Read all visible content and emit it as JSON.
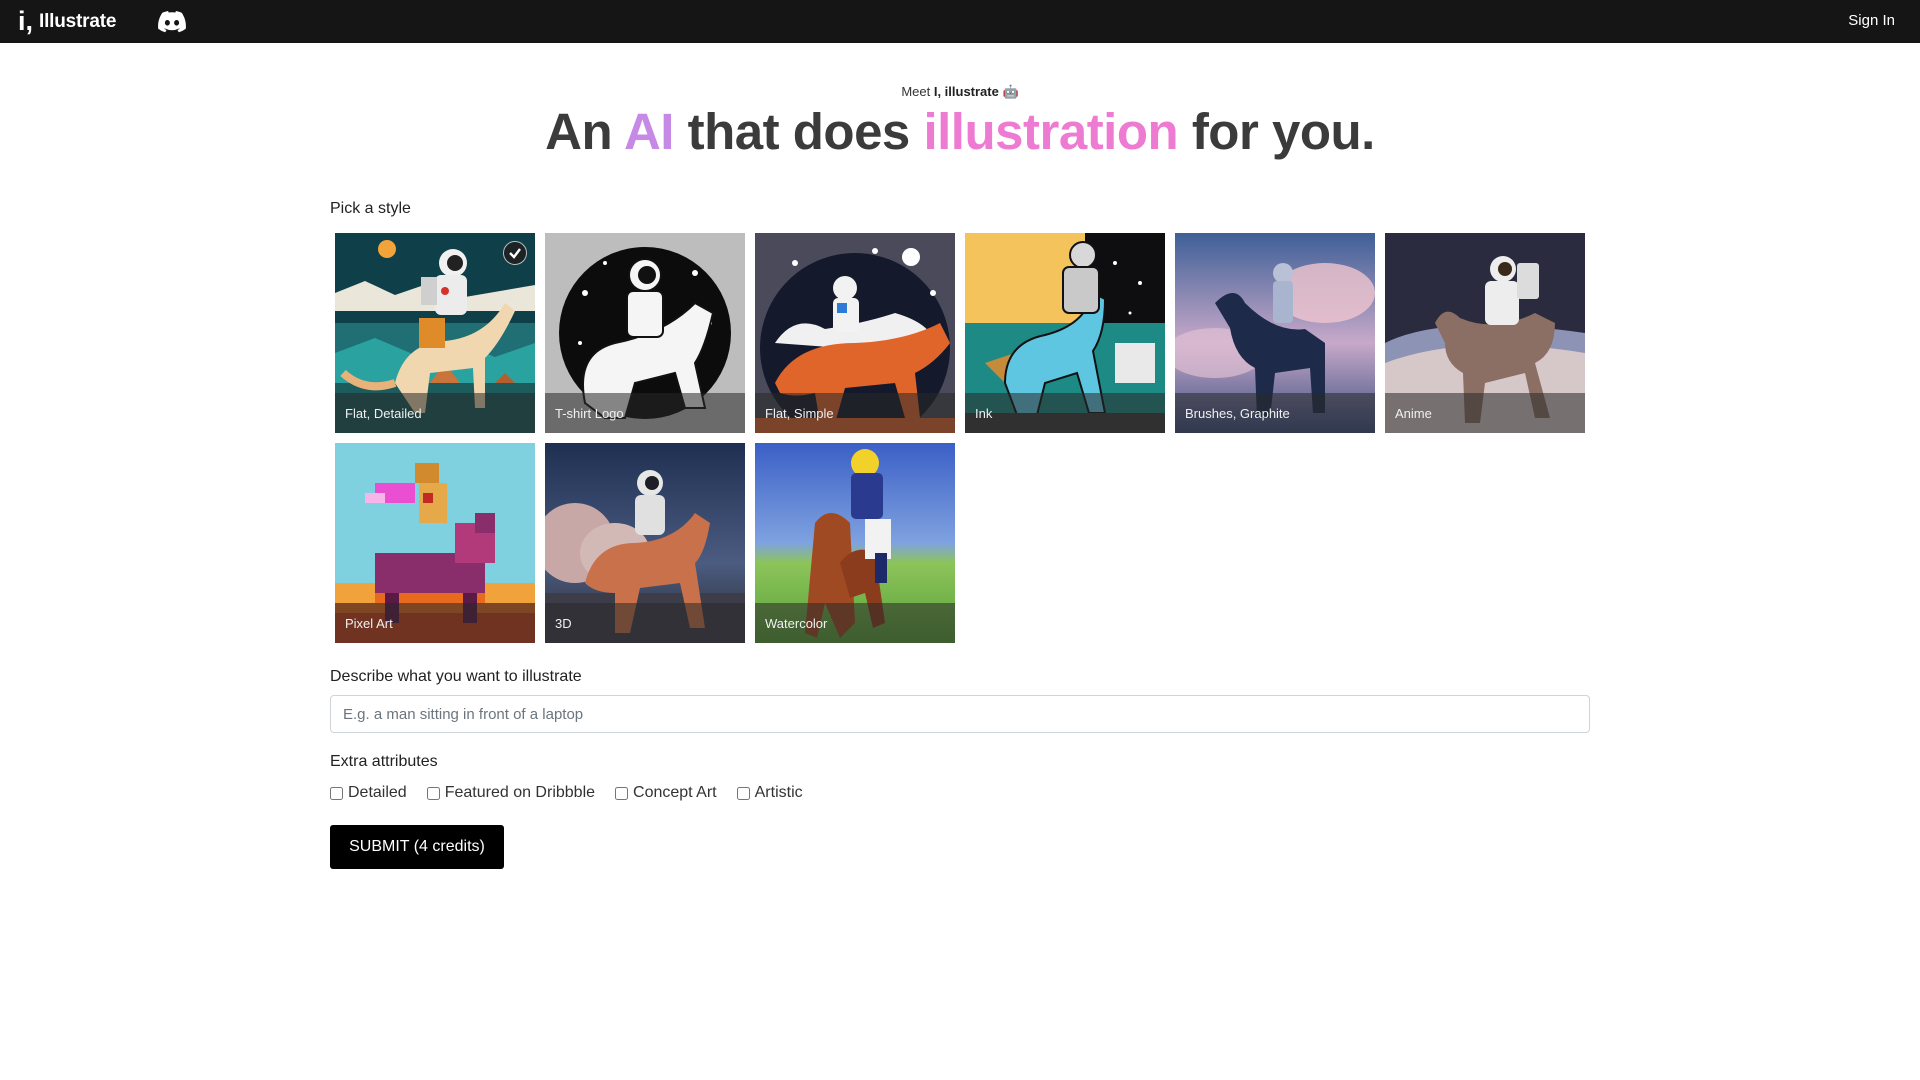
{
  "nav": {
    "logo_mark": "i,",
    "logo_text": "Illustrate",
    "discord_icon": "discord-icon",
    "signin_label": "Sign In"
  },
  "hero": {
    "eyebrow_prefix": "Meet ",
    "eyebrow_brand": "I, illustrate",
    "eyebrow_emoji": " 🤖",
    "headline_part1": "An ",
    "headline_ai": "AI",
    "headline_part2": " that does ",
    "headline_illustration": "illustration",
    "headline_part3": " for you.",
    "color_ai": "#c68ae6",
    "color_illustration": "#ee7bd2"
  },
  "styles": {
    "label": "Pick a style",
    "selected": "Flat, Detailed",
    "items": [
      {
        "name": "Flat, Detailed"
      },
      {
        "name": "T-shirt Logo"
      },
      {
        "name": "Flat, Simple"
      },
      {
        "name": "Ink"
      },
      {
        "name": "Brushes, Graphite"
      },
      {
        "name": "Anime"
      },
      {
        "name": "Pixel Art"
      },
      {
        "name": "3D"
      },
      {
        "name": "Watercolor"
      }
    ]
  },
  "description": {
    "label": "Describe what you want to illustrate",
    "placeholder": "E.g. a man sitting in front of a laptop",
    "value": ""
  },
  "extras": {
    "label": "Extra attributes",
    "options": [
      {
        "label": "Detailed",
        "checked": false
      },
      {
        "label": "Featured on Dribbble",
        "checked": false
      },
      {
        "label": "Concept Art",
        "checked": false
      },
      {
        "label": "Artistic",
        "checked": false
      }
    ]
  },
  "submit": {
    "label": "SUBMIT (4 credits)"
  }
}
